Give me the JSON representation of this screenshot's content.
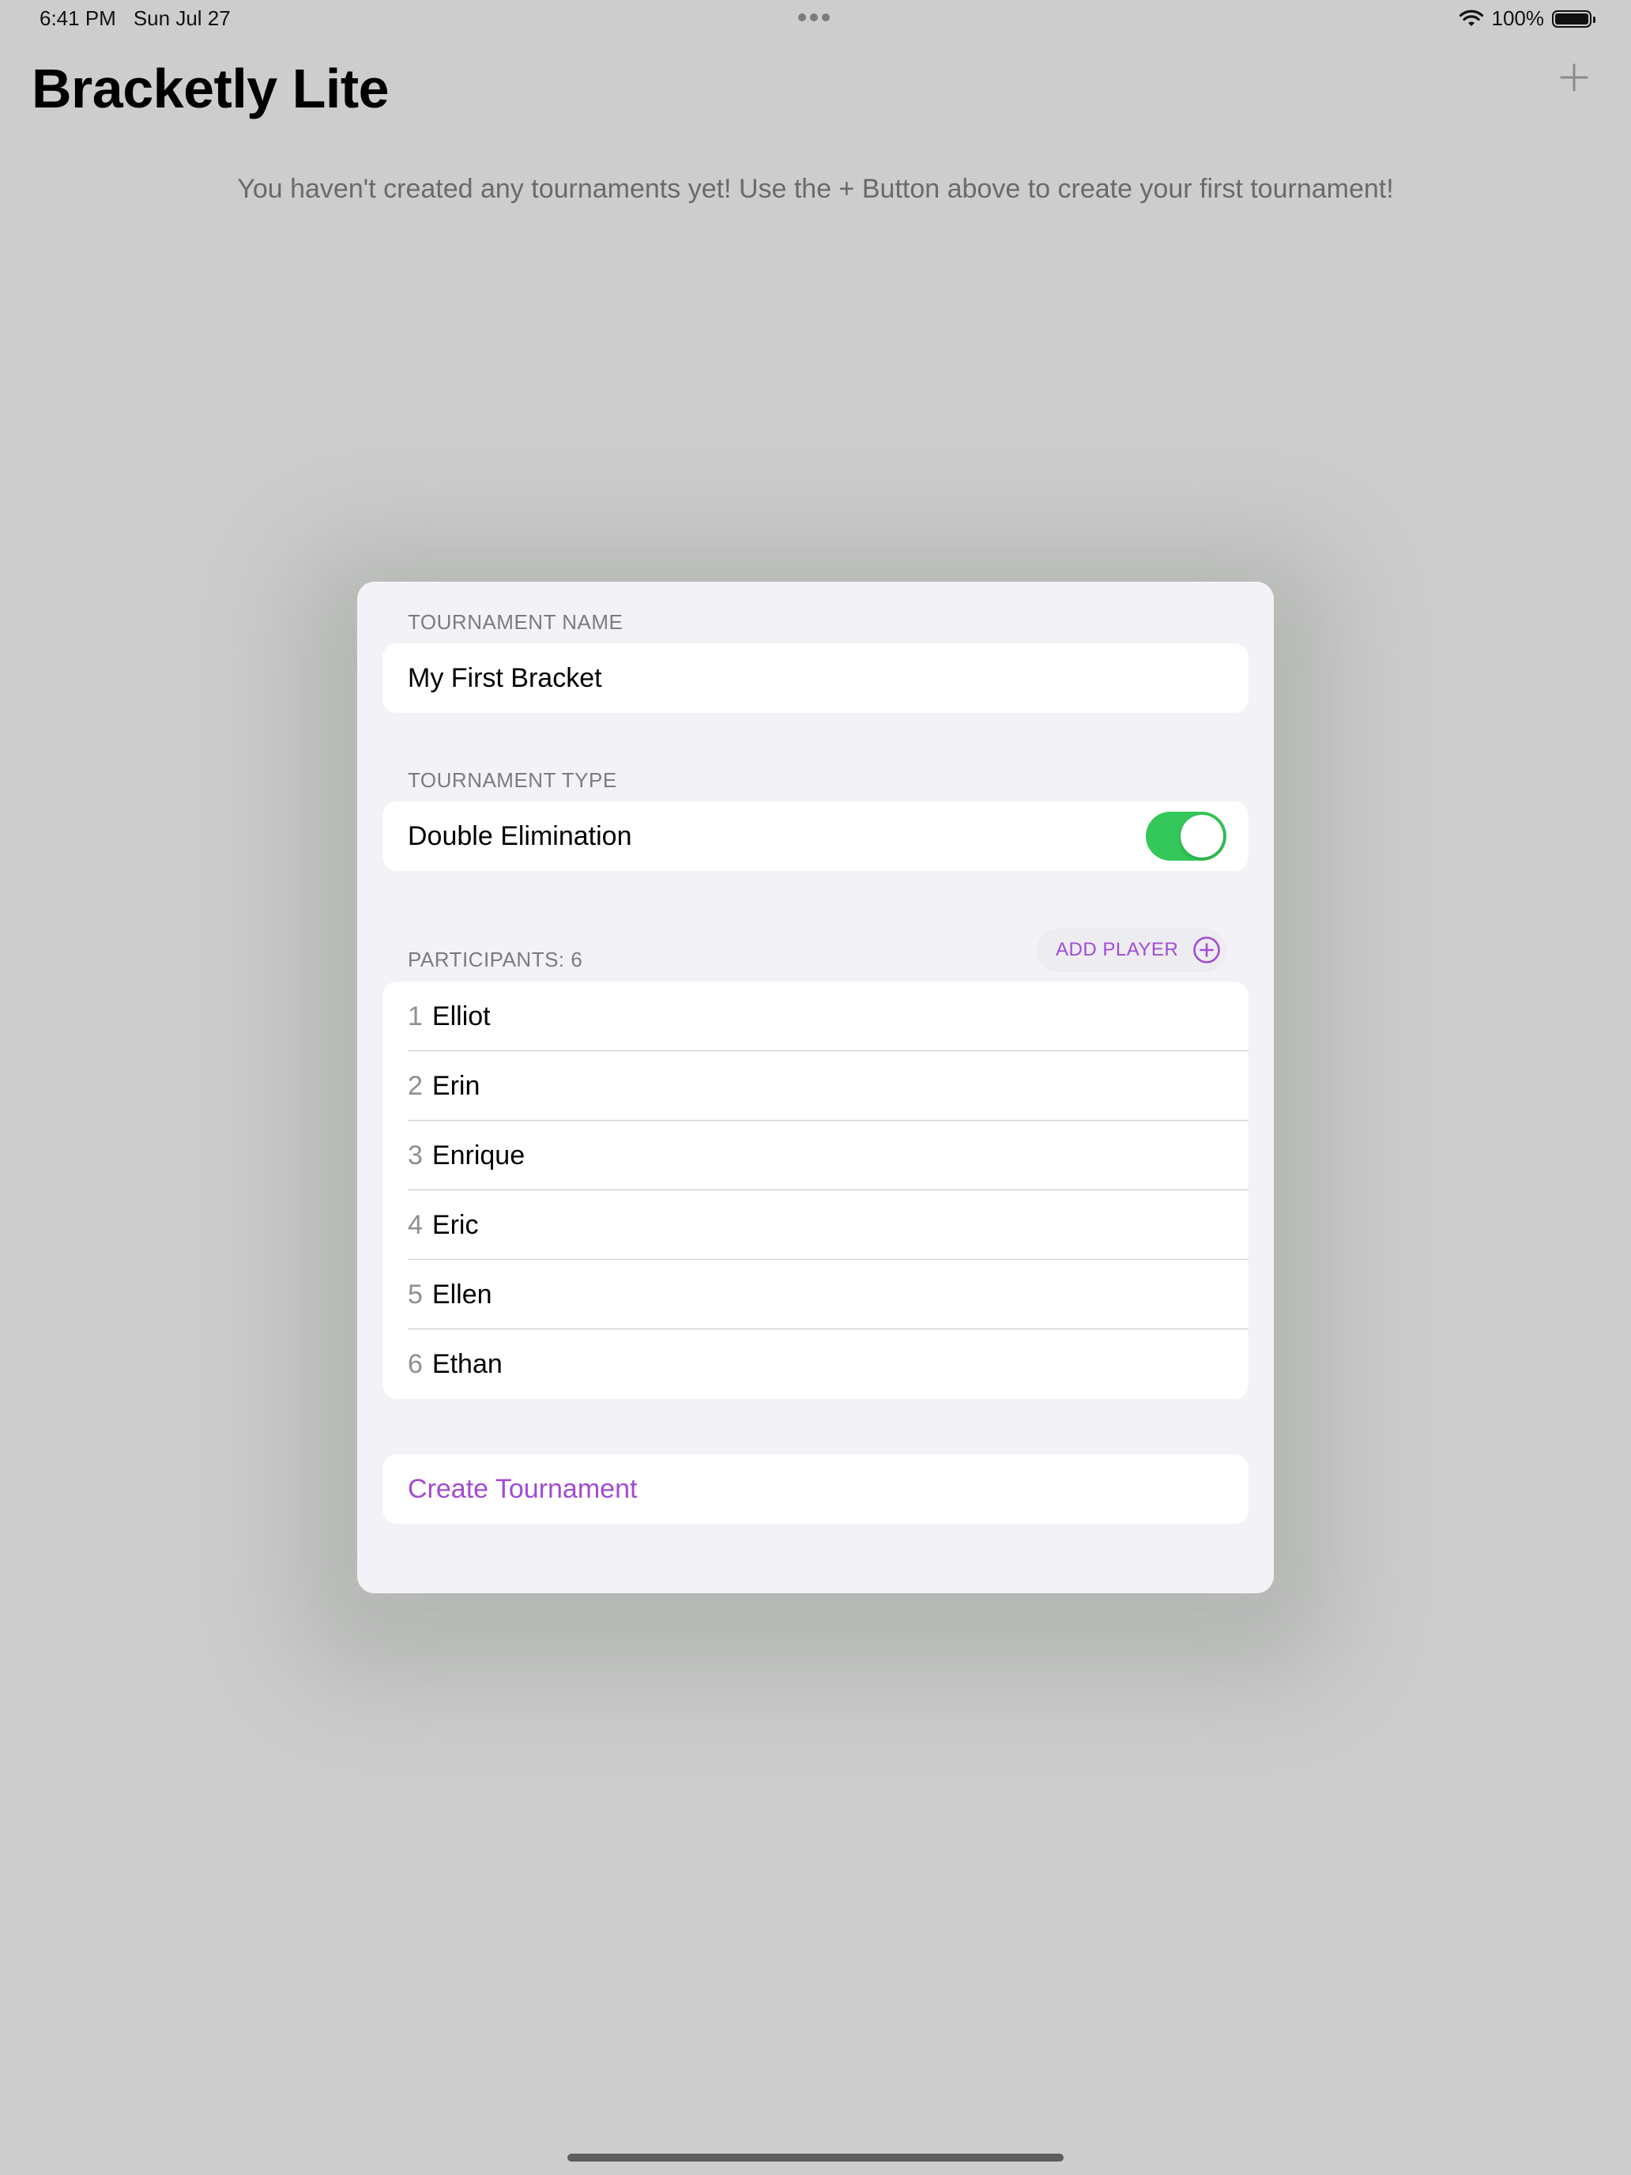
{
  "status_bar": {
    "time": "6:41 PM",
    "date": "Sun Jul 27",
    "battery": "100%"
  },
  "header": {
    "title": "Bracketly Lite",
    "add_icon": "plus-icon"
  },
  "empty_message": "You haven't created any tournaments yet! Use the + Button above to create your first tournament!",
  "modal": {
    "name_section": {
      "header": "TOURNAMENT NAME",
      "value": "My First Bracket"
    },
    "type_section": {
      "header": "TOURNAMENT TYPE",
      "label": "Double Elimination",
      "toggle_on": true
    },
    "participants_section": {
      "header": "PARTICIPANTS: 6",
      "add_player_label": "ADD PLAYER",
      "add_player_icon": "plus-circle-icon",
      "players": [
        {
          "num": "1",
          "name": "Elliot"
        },
        {
          "num": "2",
          "name": "Erin"
        },
        {
          "num": "3",
          "name": "Enrique"
        },
        {
          "num": "4",
          "name": "Eric"
        },
        {
          "num": "5",
          "name": "Ellen"
        },
        {
          "num": "6",
          "name": "Ethan"
        }
      ]
    },
    "create_button": "Create Tournament"
  },
  "colors": {
    "accent": "#a24bd6",
    "toggle_on": "#34c759",
    "backdrop": "#cdcdcd",
    "sheet_bg": "#f2f2f7"
  }
}
